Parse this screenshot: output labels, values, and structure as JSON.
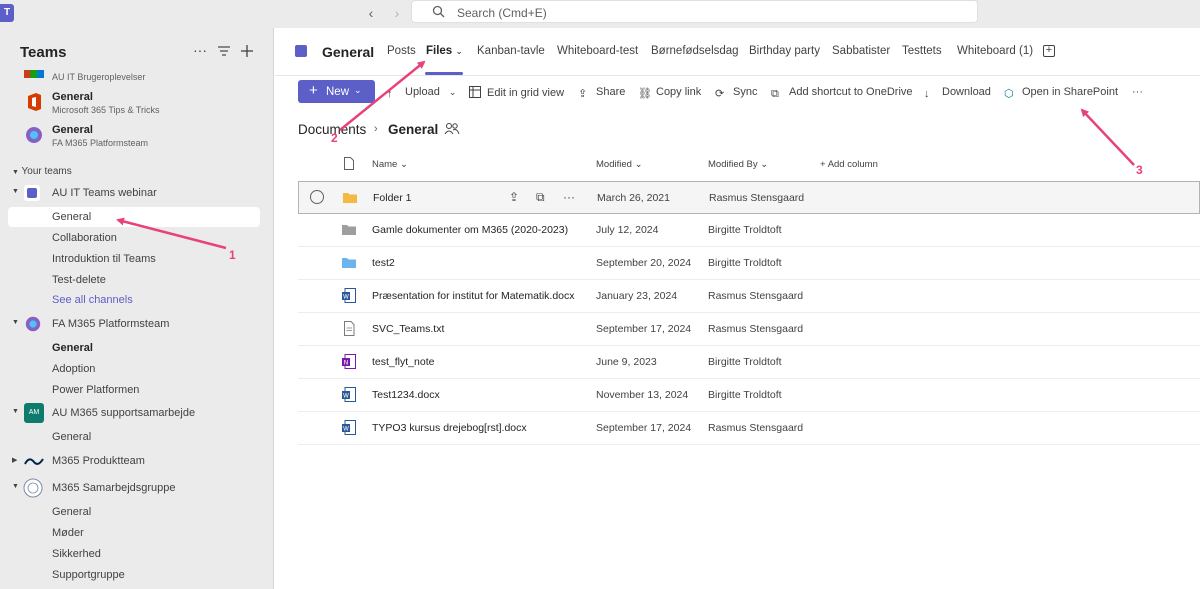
{
  "titlebar": {
    "search_placeholder": "Search (Cmd+E)",
    "back_icon": "chevron-left-icon",
    "forward_icon": "chevron-right-icon"
  },
  "sidebar": {
    "title": "Teams",
    "chats": [
      {
        "title": "",
        "subtitle": "AU IT Brugeroplevelser"
      },
      {
        "title": "General",
        "subtitle": "Microsoft 365 Tips & Tricks"
      },
      {
        "title": "General",
        "subtitle": "FA M365 Platformsteam"
      }
    ],
    "section_label": "Your teams",
    "teams": [
      {
        "name": "AU IT Teams webinar",
        "channels": [
          "General",
          "Collaboration",
          "Introduktion til Teams",
          "Test-delete",
          "See all channels"
        ]
      },
      {
        "name": "FA M365 Platformsteam",
        "channels": [
          "General",
          "Adoption",
          "Power Platformen"
        ]
      },
      {
        "name": "AU M365 supportsamarbejde",
        "avatar_text": "AM",
        "channels": [
          "General"
        ]
      },
      {
        "name": "M365 Produktteam",
        "channels": []
      },
      {
        "name": "M365 Samarbejdsgruppe",
        "channels": [
          "General",
          "Møder",
          "Sikkerhed",
          "Supportgruppe"
        ]
      }
    ]
  },
  "header": {
    "channel_title": "General",
    "tabs": [
      "Posts",
      "Files",
      "Kanban-tavle",
      "Whiteboard-test",
      "Børnefødselsdag",
      "Birthday party",
      "Sabbatister",
      "Testtets",
      "Whiteboard (1)"
    ]
  },
  "toolbar": {
    "new": "New",
    "upload": "Upload",
    "edit_grid": "Edit in grid view",
    "share": "Share",
    "copy_link": "Copy link",
    "sync": "Sync",
    "add_shortcut": "Add shortcut to OneDrive",
    "download": "Download",
    "open_sharepoint": "Open in SharePoint",
    "more": "···"
  },
  "breadcrumb": {
    "root": "Documents",
    "current": "General"
  },
  "columns": {
    "name": "Name",
    "modified": "Modified",
    "modified_by": "Modified By",
    "add_column": "Add column"
  },
  "files": [
    {
      "name": "Folder 1",
      "modified": "March 26, 2021",
      "by": "Rasmus Stensgaard",
      "type": "folder-yellow"
    },
    {
      "name": "Gamle dokumenter om M365 (2020-2023)",
      "modified": "July 12, 2024",
      "by": "Birgitte Troldtoft",
      "type": "folder-gray"
    },
    {
      "name": "test2",
      "modified": "September 20, 2024",
      "by": "Birgitte Troldtoft",
      "type": "folder-blue"
    },
    {
      "name": "Præsentation for institut for Matematik.docx",
      "modified": "January 23, 2024",
      "by": "Rasmus Stensgaard",
      "type": "word"
    },
    {
      "name": "SVC_Teams.txt",
      "modified": "September 17, 2024",
      "by": "Rasmus Stensgaard",
      "type": "txt"
    },
    {
      "name": "test_flyt_note",
      "modified": "June 9, 2023",
      "by": "Birgitte Troldtoft",
      "type": "onenote"
    },
    {
      "name": "Test1234.docx",
      "modified": "November 13, 2024",
      "by": "Birgitte Troldtoft",
      "type": "word"
    },
    {
      "name": "TYPO3 kursus drejebog[rst].docx",
      "modified": "September 17, 2024",
      "by": "Rasmus Stensgaard",
      "type": "word"
    }
  ],
  "annotations": {
    "one": "1",
    "two": "2",
    "three": "3",
    "color": "#e8427a"
  },
  "colors": {
    "accent": "#5b5fc7",
    "sidebar_bg": "#ebebeb"
  }
}
